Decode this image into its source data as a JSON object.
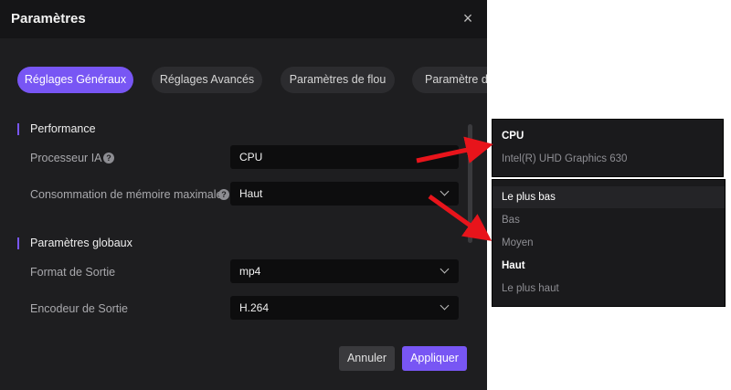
{
  "dialog": {
    "title": "Paramètres",
    "close_symbol": "×",
    "tabs": [
      {
        "label": "Réglages Généraux",
        "active": true
      },
      {
        "label": "Réglages Avancés"
      },
      {
        "label": "Paramètres de flou"
      },
      {
        "label": "Paramètre de"
      }
    ],
    "sections": [
      {
        "title": "Performance",
        "rows": [
          {
            "label": "Processeur IA",
            "value": "CPU",
            "help": "?"
          },
          {
            "label": "Consommation de mémoire maximale",
            "value": "Haut",
            "help": "?"
          }
        ]
      },
      {
        "title": "Paramètres globaux",
        "rows": [
          {
            "label": "Format de Sortie",
            "value": "mp4"
          },
          {
            "label": "Encodeur de Sortie",
            "value": "H.264"
          }
        ]
      }
    ],
    "buttons": {
      "cancel": "Annuler",
      "apply": "Appliquer"
    }
  },
  "dropdown_processor": {
    "options": [
      "CPU",
      "Intel(R) UHD Graphics 630"
    ]
  },
  "dropdown_memory": {
    "options": [
      "Le plus bas",
      "Bas",
      "Moyen",
      "Haut",
      "Le plus haut"
    ]
  },
  "colors": {
    "accent": "#7856f4",
    "arrow": "#e8141b"
  },
  "icons": [
    "close-icon",
    "help-icon",
    "chevron-down-icon",
    "red-arrow-annotation"
  ]
}
